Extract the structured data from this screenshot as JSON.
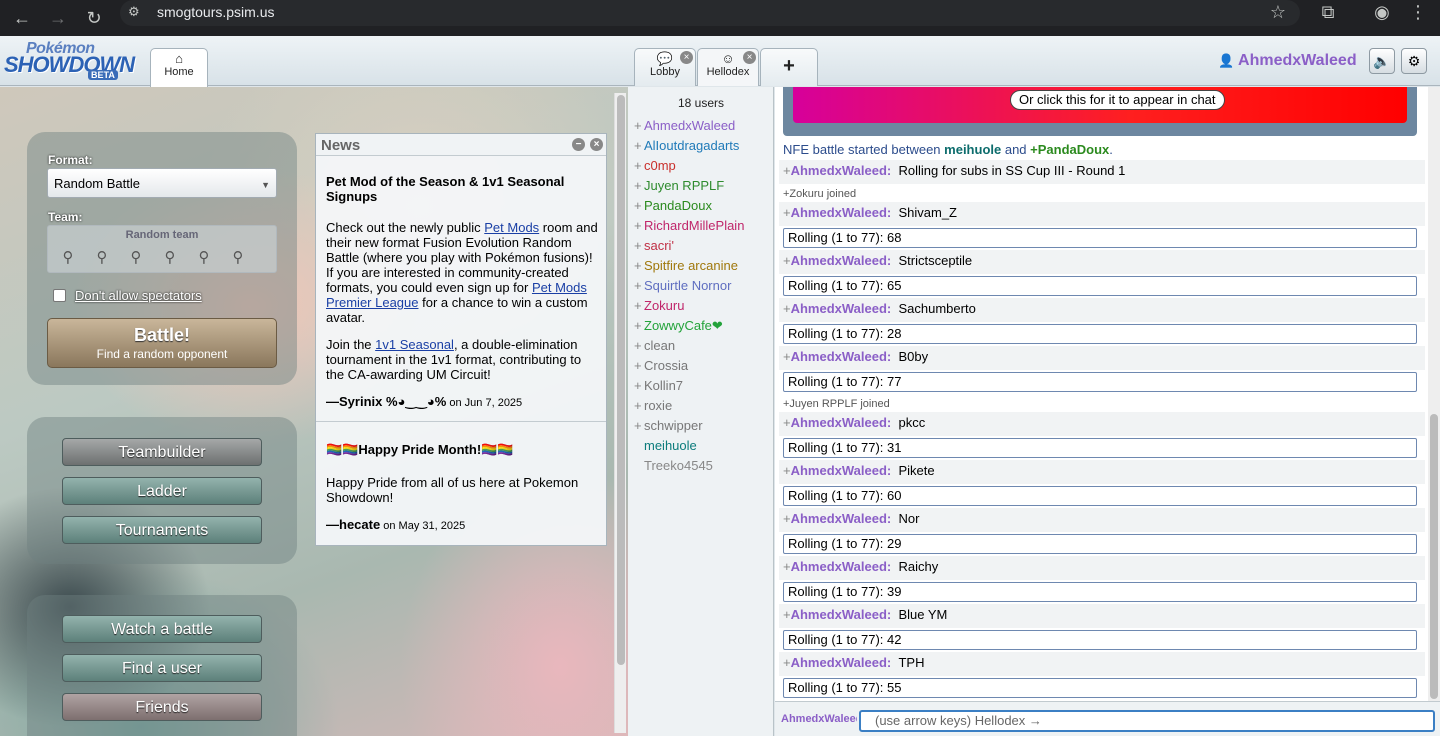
{
  "browser": {
    "url": "smogtours.psim.us",
    "icons": [
      "back-icon",
      "forward-icon",
      "reload-icon",
      "site-info-icon",
      "bookmark-star-icon",
      "extensions-icon",
      "profile-icon",
      "menu-icon"
    ]
  },
  "header": {
    "logo_top": "Pokémon",
    "logo_main": "SHOWDOWN",
    "logo_badge": "BETA",
    "tabs": [
      {
        "label": "Home",
        "icon": "⌂"
      },
      {
        "label": "Lobby",
        "icon": "💬"
      },
      {
        "label": "Hellodex",
        "icon": "☺"
      }
    ],
    "new_tab_label": "+",
    "username": "AhmedxWaleed"
  },
  "home": {
    "format_label": "Format:",
    "format_value": "Random Battle",
    "team_label": "Team:",
    "team_value": "Random team",
    "spectators_label": "Don't allow spectators",
    "battle_label": "Battle!",
    "battle_sub": "Find a random opponent",
    "menu": [
      "Teambuilder",
      "Ladder",
      "Tournaments"
    ],
    "menu2": [
      "Watch a battle",
      "Find a user",
      "Friends"
    ]
  },
  "news": {
    "title": "News",
    "item1": {
      "title": "Pet Mod of the Season & 1v1 Seasonal Signups",
      "p1_a": "Check out the newly public ",
      "p1_link": "Pet Mods",
      "p1_b": " room and their new format Fusion Evolution Random Battle (where you play with Pokémon fusions)! If you are interested in community-created formats, you could even sign up for ",
      "p1_link2": "Pet Mods Premier League",
      "p1_c": " for a chance to win a custom avatar.",
      "p2_a": "Join the ",
      "p2_link": "1v1 Seasonal",
      "p2_b": ", a double-elimination tournament in the 1v1 format, contributing to the CA-awarding UM Circuit!",
      "sig": "—Syrinix %◕‿‿◕%",
      "date": " on Jun 7, 2025"
    },
    "item2": {
      "title": "🏳️‍🌈🏳️‍🌈Happy Pride Month!🏳️‍🌈🏳️‍🌈",
      "body": "Happy Pride from all of us here at Pokemon Showdown!",
      "sig": "—hecate",
      "date": " on May 31, 2025"
    }
  },
  "userlist": {
    "count": "18 users",
    "users": [
      {
        "rank": "+",
        "name": "AhmedxWaleed",
        "color": "#8b5fc7"
      },
      {
        "rank": "+",
        "name": "AlIoutdragadarts",
        "color": "#1f7ab8"
      },
      {
        "rank": "+",
        "name": "c0mp",
        "color": "#c9302c"
      },
      {
        "rank": "+",
        "name": "Juyen RPPLF",
        "color": "#2e8b2e"
      },
      {
        "rank": "+",
        "name": "PandaDoux",
        "color": "#2b8a1e"
      },
      {
        "rank": "+",
        "name": "RichardMillePlain",
        "color": "#c0266a"
      },
      {
        "rank": "+",
        "name": "sacri'",
        "color": "#c03045"
      },
      {
        "rank": "+",
        "name": "Spitfire arcanine",
        "color": "#a0780b"
      },
      {
        "rank": "+",
        "name": "Squirtle Nornor",
        "color": "#5f6ec0"
      },
      {
        "rank": "+",
        "name": "Zokuru",
        "color": "#c0266a"
      },
      {
        "rank": "+",
        "name": "ZowwyCafe❤",
        "color": "#23a33a"
      },
      {
        "rank": "+",
        "name": "clean",
        "color": "#777777"
      },
      {
        "rank": "+",
        "name": "Crossia",
        "color": "#777777"
      },
      {
        "rank": "+",
        "name": "Kollin7",
        "color": "#777777"
      },
      {
        "rank": "+",
        "name": "roxie",
        "color": "#777777"
      },
      {
        "rank": "+",
        "name": "schwipper",
        "color": "#777777"
      },
      {
        "rank": "",
        "name": "meihuole",
        "color": "#0c7c7c"
      },
      {
        "rank": "",
        "name": "Treeko4545",
        "color": "#888888"
      }
    ]
  },
  "chat": {
    "banner_button": "Or click this for it to appear in chat",
    "notice_a": "NFE battle started between ",
    "notice_p1": "meihuole",
    "notice_and": " and ",
    "notice_p2": "+PandaDoux",
    "notice_end": ".",
    "sender": "AhmedxWaleed:",
    "rows": [
      {
        "type": "msg",
        "text": "Rolling for subs in SS Cup III - Round 1"
      },
      {
        "type": "join",
        "text": "+Zokuru joined"
      },
      {
        "type": "msg",
        "text": "Shivam_Z"
      },
      {
        "type": "roll",
        "text": "Rolling (1 to 77): 68"
      },
      {
        "type": "msg",
        "text": "Strictsceptile"
      },
      {
        "type": "roll",
        "text": "Rolling (1 to 77): 65"
      },
      {
        "type": "msg",
        "text": "Sachumberto"
      },
      {
        "type": "roll",
        "text": "Rolling (1 to 77): 28"
      },
      {
        "type": "msg",
        "text": "B0by"
      },
      {
        "type": "roll",
        "text": "Rolling (1 to 77): 77"
      },
      {
        "type": "join",
        "text": "+Juyen RPPLF joined"
      },
      {
        "type": "msg",
        "text": "pkcc"
      },
      {
        "type": "roll",
        "text": "Rolling (1 to 77): 31"
      },
      {
        "type": "msg",
        "text": "Pikete"
      },
      {
        "type": "roll",
        "text": "Rolling (1 to 77): 60"
      },
      {
        "type": "msg",
        "text": "Nor"
      },
      {
        "type": "roll",
        "text": "Rolling (1 to 77): 29"
      },
      {
        "type": "msg",
        "text": "Raichy"
      },
      {
        "type": "roll",
        "text": "Rolling (1 to 77): 39"
      },
      {
        "type": "msg",
        "text": "Blue YM"
      },
      {
        "type": "roll",
        "text": "Rolling (1 to 77): 42"
      },
      {
        "type": "msg",
        "text": "TPH"
      },
      {
        "type": "roll",
        "text": "Rolling (1 to 77): 55"
      }
    ],
    "input_name": "AhmedxWaleed",
    "input_placeholder": "(use arrow keys) Hellodex →"
  }
}
